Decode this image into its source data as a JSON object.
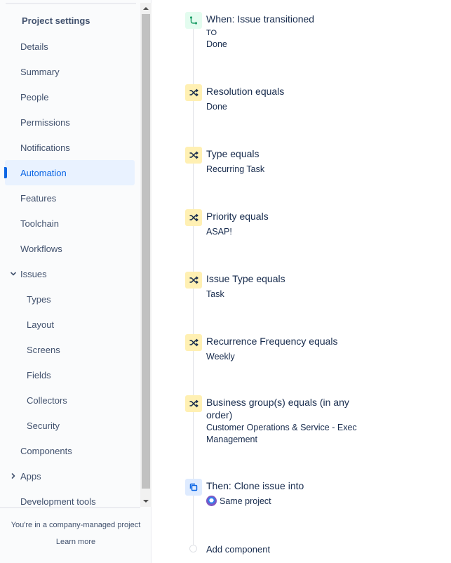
{
  "sidebar": {
    "title": "Project settings",
    "items": [
      {
        "label": "Details"
      },
      {
        "label": "Summary"
      },
      {
        "label": "People"
      },
      {
        "label": "Permissions"
      },
      {
        "label": "Notifications"
      },
      {
        "label": "Automation"
      },
      {
        "label": "Features"
      },
      {
        "label": "Toolchain"
      },
      {
        "label": "Workflows"
      },
      {
        "label": "Issues"
      },
      {
        "label": "Types"
      },
      {
        "label": "Layout"
      },
      {
        "label": "Screens"
      },
      {
        "label": "Fields"
      },
      {
        "label": "Collectors"
      },
      {
        "label": "Security"
      },
      {
        "label": "Components"
      },
      {
        "label": "Apps"
      },
      {
        "label": "Development tools"
      }
    ],
    "active_item": "Automation",
    "footer_text": "You're in a company-managed project",
    "footer_link": "Learn more"
  },
  "rule": {
    "trigger": {
      "title": "When: Issue transitioned",
      "line1": "TO",
      "line2": "Done",
      "icon": "branch-icon"
    },
    "conditions": [
      {
        "title": "Resolution equals",
        "value": "Done",
        "icon": "shuffle-icon"
      },
      {
        "title": "Type equals",
        "value": "Recurring Task",
        "icon": "shuffle-icon"
      },
      {
        "title": "Priority equals",
        "value": "ASAP!",
        "icon": "shuffle-icon"
      },
      {
        "title": "Issue Type equals",
        "value": "Task",
        "icon": "shuffle-icon"
      },
      {
        "title": "Recurrence Frequency equals",
        "value": "Weekly",
        "icon": "shuffle-icon"
      },
      {
        "title": "Business group(s) equals (in any order)",
        "value": "Customer Operations & Service - Exec Management",
        "icon": "shuffle-icon"
      }
    ],
    "action": {
      "title": "Then: Clone issue into",
      "value": "Same project",
      "icon": "copy-icon"
    },
    "add_component": "Add component"
  },
  "colors": {
    "active_accent": "#0c66e4",
    "trigger_bg": "#e3fcef",
    "condition_bg": "#fff0b3",
    "action_bg": "#deebff"
  }
}
